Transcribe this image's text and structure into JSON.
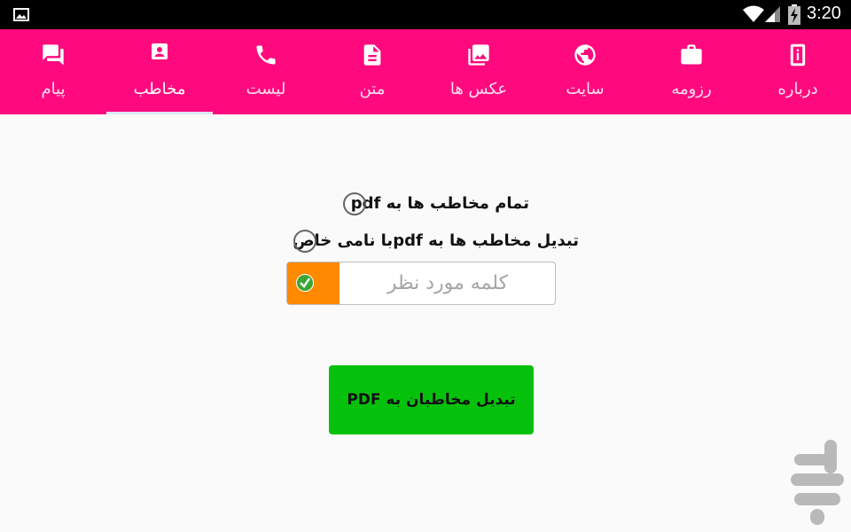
{
  "status_bar": {
    "time": "3:20"
  },
  "tabs": [
    {
      "label": "پیام",
      "icon": "forum-icon",
      "active": false
    },
    {
      "label": "مخاطب",
      "icon": "contact-icon",
      "active": true
    },
    {
      "label": "لیست",
      "icon": "phone-icon",
      "active": false
    },
    {
      "label": "متن",
      "icon": "document-icon",
      "active": false
    },
    {
      "label": "عکس ها",
      "icon": "photo-library-icon",
      "active": false
    },
    {
      "label": "سایت",
      "icon": "globe-icon",
      "active": false
    },
    {
      "label": "رزومه",
      "icon": "briefcase-icon",
      "active": false
    },
    {
      "label": "درباره",
      "icon": "info-icon",
      "active": false
    }
  ],
  "options": {
    "all_contacts_label": "تمام مخاطب ها به pdf",
    "custom_name_label": "تبدیل مخاطب ها به pdfبا نامی خاص"
  },
  "name_input": {
    "placeholder": "کلمه مورد نظر",
    "value": ""
  },
  "convert_button": {
    "label": "تبدیل مخاطبان به PDF"
  },
  "colors": {
    "accent": "#ff0a7e",
    "button": "#06c10c",
    "check_box": "#ff8a00"
  }
}
